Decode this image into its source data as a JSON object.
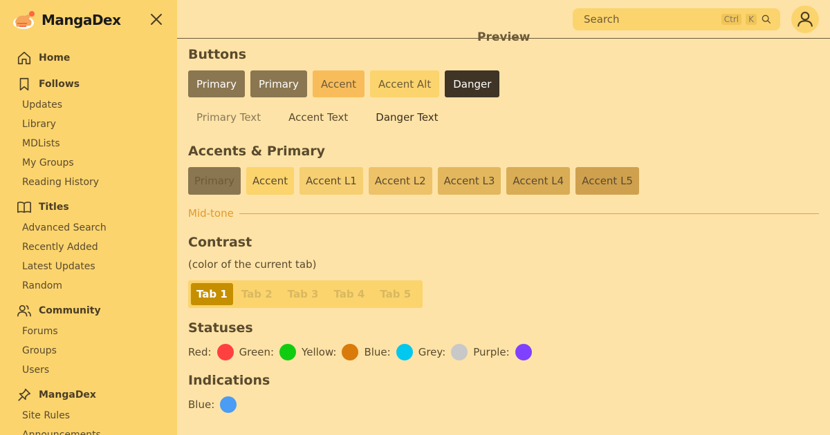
{
  "app": {
    "name": "MangaDex"
  },
  "sidebar": {
    "sections": [
      {
        "label": "Home",
        "icon": "home-icon",
        "items": []
      },
      {
        "label": "Follows",
        "icon": "bookmark-icon",
        "items": [
          "Updates",
          "Library",
          "MDLists",
          "My Groups",
          "Reading History"
        ]
      },
      {
        "label": "Titles",
        "icon": "book-icon",
        "items": [
          "Advanced Search",
          "Recently Added",
          "Latest Updates",
          "Random"
        ]
      },
      {
        "label": "Community",
        "icon": "users-icon",
        "items": [
          "Forums",
          "Groups",
          "Users"
        ]
      },
      {
        "label": "MangaDex",
        "icon": "pin-icon",
        "items": [
          "Site Rules",
          "Announcements"
        ]
      }
    ]
  },
  "header": {
    "search_placeholder": "Search",
    "shortcut_ctrl": "Ctrl",
    "shortcut_key": "K"
  },
  "main": {
    "preview_heading": "Preview",
    "buttons_title": "Buttons",
    "buttons": [
      {
        "label": "Primary",
        "bg": "#8a7650",
        "fg": "#ffffff"
      },
      {
        "label": "Primary",
        "bg": "#8a7650",
        "fg": "#ffffff"
      },
      {
        "label": "Accent",
        "bg": "#f8bd5a",
        "fg": "#6b5a3a"
      },
      {
        "label": "Accent Alt",
        "bg": "#fbd46d",
        "fg": "#6b5a3a"
      },
      {
        "label": "Danger",
        "bg": "#3f3425",
        "fg": "#ffffff"
      }
    ],
    "text_buttons": [
      {
        "label": "Primary Text",
        "fg": "#8a7858"
      },
      {
        "label": "Accent Text",
        "fg": "#5a4a2e"
      },
      {
        "label": "Danger Text",
        "fg": "#3a2f1f"
      }
    ],
    "accents_title": "Accents & Primary",
    "accents": [
      {
        "label": "Primary",
        "bg": "#8a7650",
        "fg": "#6b5a3a"
      },
      {
        "label": "Accent",
        "bg": "#fbd46d",
        "fg": "#5a4a2e"
      },
      {
        "label": "Accent L1",
        "bg": "#f6cf72",
        "fg": "#5a4a2e"
      },
      {
        "label": "Accent L2",
        "bg": "#eec268",
        "fg": "#5a4a2e"
      },
      {
        "label": "Accent L3",
        "bg": "#e3b75e",
        "fg": "#5a4a2e"
      },
      {
        "label": "Accent L4",
        "bg": "#d9ac56",
        "fg": "#5a4a2e"
      },
      {
        "label": "Accent L5",
        "bg": "#cfa14e",
        "fg": "#5a4a2e"
      }
    ],
    "midtone_label": "Mid-tone",
    "contrast_title": "Contrast",
    "contrast_note": "(color of the current tab)",
    "tabs": [
      "Tab 1",
      "Tab 2",
      "Tab 3",
      "Tab 4",
      "Tab 5"
    ],
    "active_tab": "Tab 1",
    "statuses_title": "Statuses",
    "statuses": [
      {
        "label": "Red:",
        "color": "#ff4040"
      },
      {
        "label": "Green:",
        "color": "#10cc10"
      },
      {
        "label": "Yellow:",
        "color": "#d97a0a"
      },
      {
        "label": "Blue:",
        "color": "#00c8ee"
      },
      {
        "label": "Grey:",
        "color": "#c8c8c8"
      },
      {
        "label": "Purple:",
        "color": "#8040ff"
      }
    ],
    "indications_title": "Indications",
    "indications": [
      {
        "label": "Blue:",
        "color": "#4a9cf5"
      }
    ]
  }
}
